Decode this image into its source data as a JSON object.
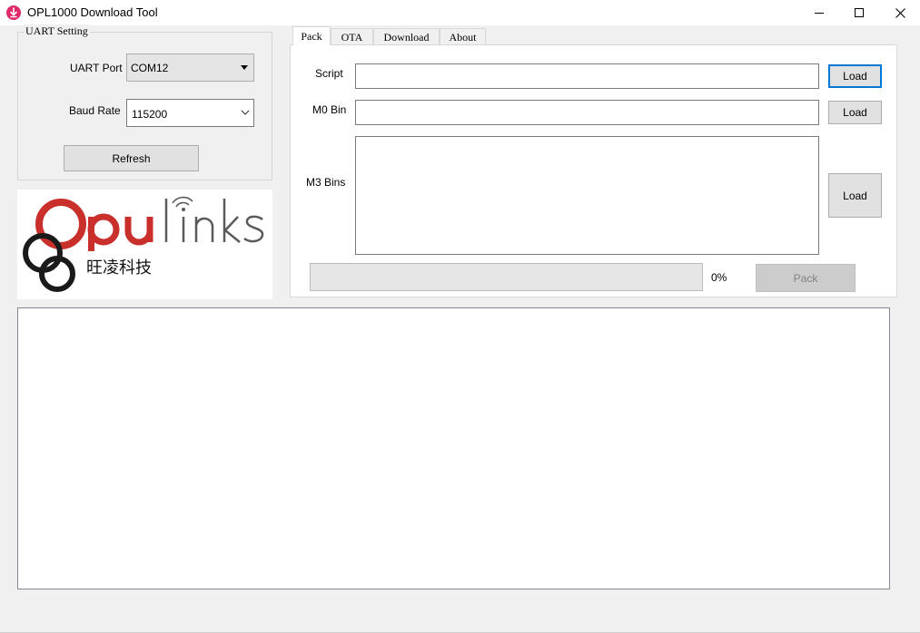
{
  "window": {
    "title": "OPL1000 Download Tool",
    "controls": [
      "minimize",
      "maximize",
      "close"
    ],
    "accent_color": "#e0286a"
  },
  "uart": {
    "group_title": "UART Setting",
    "port_label": "UART Port",
    "port_value": "COM12",
    "baud_label": "Baud Rate",
    "baud_value": "115200",
    "refresh_label": "Refresh"
  },
  "logo": {
    "wordmark": "Opulinks",
    "chinese": "旺凌科技",
    "brand_color": "#c9302c"
  },
  "tabs": [
    {
      "label": "Pack",
      "active": true
    },
    {
      "label": "OTA",
      "active": false
    },
    {
      "label": "Download",
      "active": false
    },
    {
      "label": "About",
      "active": false
    }
  ],
  "pack": {
    "script_label": "Script",
    "script_value": "",
    "m0_label": "M0 Bin",
    "m0_value": "",
    "m3_label": "M3 Bins",
    "m3_value": "",
    "load_label": "Load",
    "progress_text": "0%",
    "progress_value": 0,
    "pack_label": "Pack"
  },
  "log": {
    "content": ""
  }
}
